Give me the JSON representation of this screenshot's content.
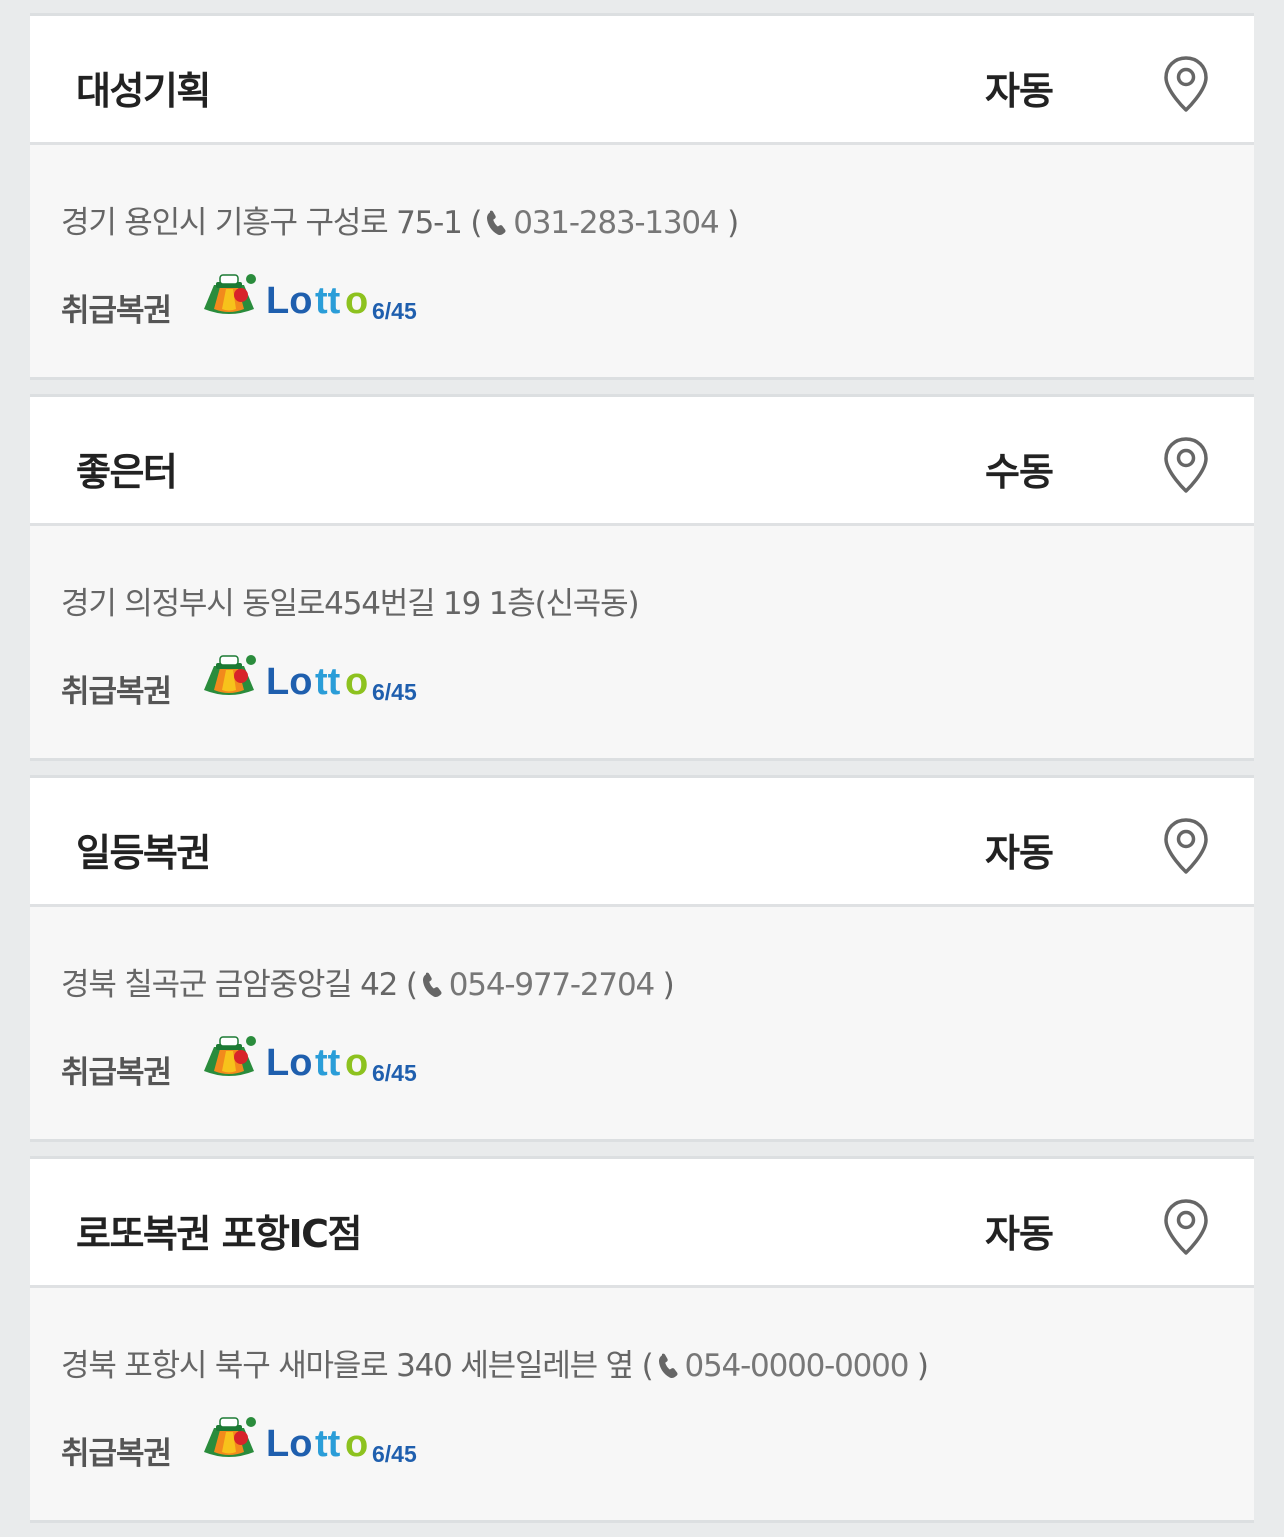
{
  "stores": [
    {
      "name": "대성기획",
      "sale_type": "자동",
      "address": "경기 용인시 기흥구 구성로 75-1",
      "phone": "031-283-1304",
      "ticket_label": "취급복권",
      "ticket_logo": "Lotto6/45"
    },
    {
      "name": "좋은터",
      "sale_type": "수동",
      "address": "경기 의정부시 동일로454번길 19 1층(신곡동)",
      "phone": null,
      "ticket_label": "취급복권",
      "ticket_logo": "Lotto6/45"
    },
    {
      "name": "일등복권",
      "sale_type": "자동",
      "address": "경북 칠곡군 금암중앙길 42",
      "phone": "054-977-2704",
      "ticket_label": "취급복권",
      "ticket_logo": "Lotto6/45"
    },
    {
      "name": "로또복권 포항IC점",
      "sale_type": "자동",
      "address": "경북 포항시 북구 새마을로 340 세븐일레븐 옆",
      "phone": "054-0000-0000",
      "ticket_label": "취급복권",
      "ticket_logo": "Lotto6/45"
    }
  ],
  "icons": {
    "map": "map-pin-icon",
    "phone": "phone-icon"
  },
  "colors": {
    "lotto_blue": "#1f5fae",
    "lotto_green": "#8dc21f",
    "pin": "#666666"
  }
}
